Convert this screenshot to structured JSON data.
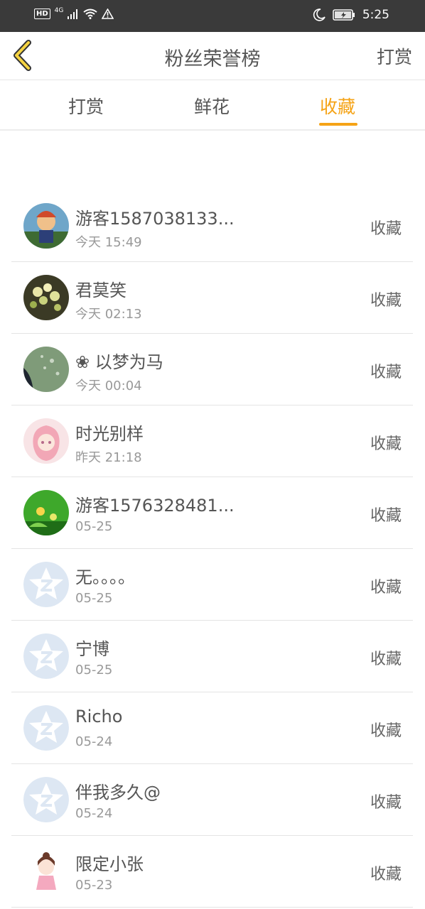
{
  "status_bar": {
    "left_badge": "HD",
    "network": "4G",
    "time": "5:25"
  },
  "nav": {
    "title": "粉丝荣誉榜",
    "action": "打赏"
  },
  "tabs": [
    {
      "label": "打赏",
      "active": false
    },
    {
      "label": "鲜花",
      "active": false
    },
    {
      "label": "收藏",
      "active": true
    }
  ],
  "list": [
    {
      "name": "游客1587038133...",
      "time": "今天 15:49",
      "action": "收藏",
      "avatar": "photo-cartoon"
    },
    {
      "name": "君莫笑",
      "time": "今天 02:13",
      "action": "收藏",
      "avatar": "photo-flowers"
    },
    {
      "name": "❀ 以梦为马",
      "time": "今天 00:04",
      "action": "收藏",
      "avatar": "photo-rain"
    },
    {
      "name": "时光别样",
      "time": "昨天 21:18",
      "action": "收藏",
      "avatar": "photo-anime-girl"
    },
    {
      "name": "游客1576328481...",
      "time": "05-25",
      "action": "收藏",
      "avatar": "photo-green"
    },
    {
      "name": "无。。。。",
      "time": "05-25",
      "action": "收藏",
      "avatar": "default-qq-star"
    },
    {
      "name": "宁博",
      "time": "05-25",
      "action": "收藏",
      "avatar": "default-qq-star"
    },
    {
      "name": "Richo",
      "time": "05-24",
      "action": "收藏",
      "avatar": "default-qq-star"
    },
    {
      "name": "伴我多久@",
      "time": "05-24",
      "action": "收藏",
      "avatar": "default-qq-star"
    },
    {
      "name": "限定小张",
      "time": "05-23",
      "action": "收藏",
      "avatar": "photo-cartoon-girl"
    }
  ],
  "colors": {
    "accent": "#f5a316",
    "status_bar": "#3a3a3a",
    "default_avatar": "#dde7f3"
  }
}
